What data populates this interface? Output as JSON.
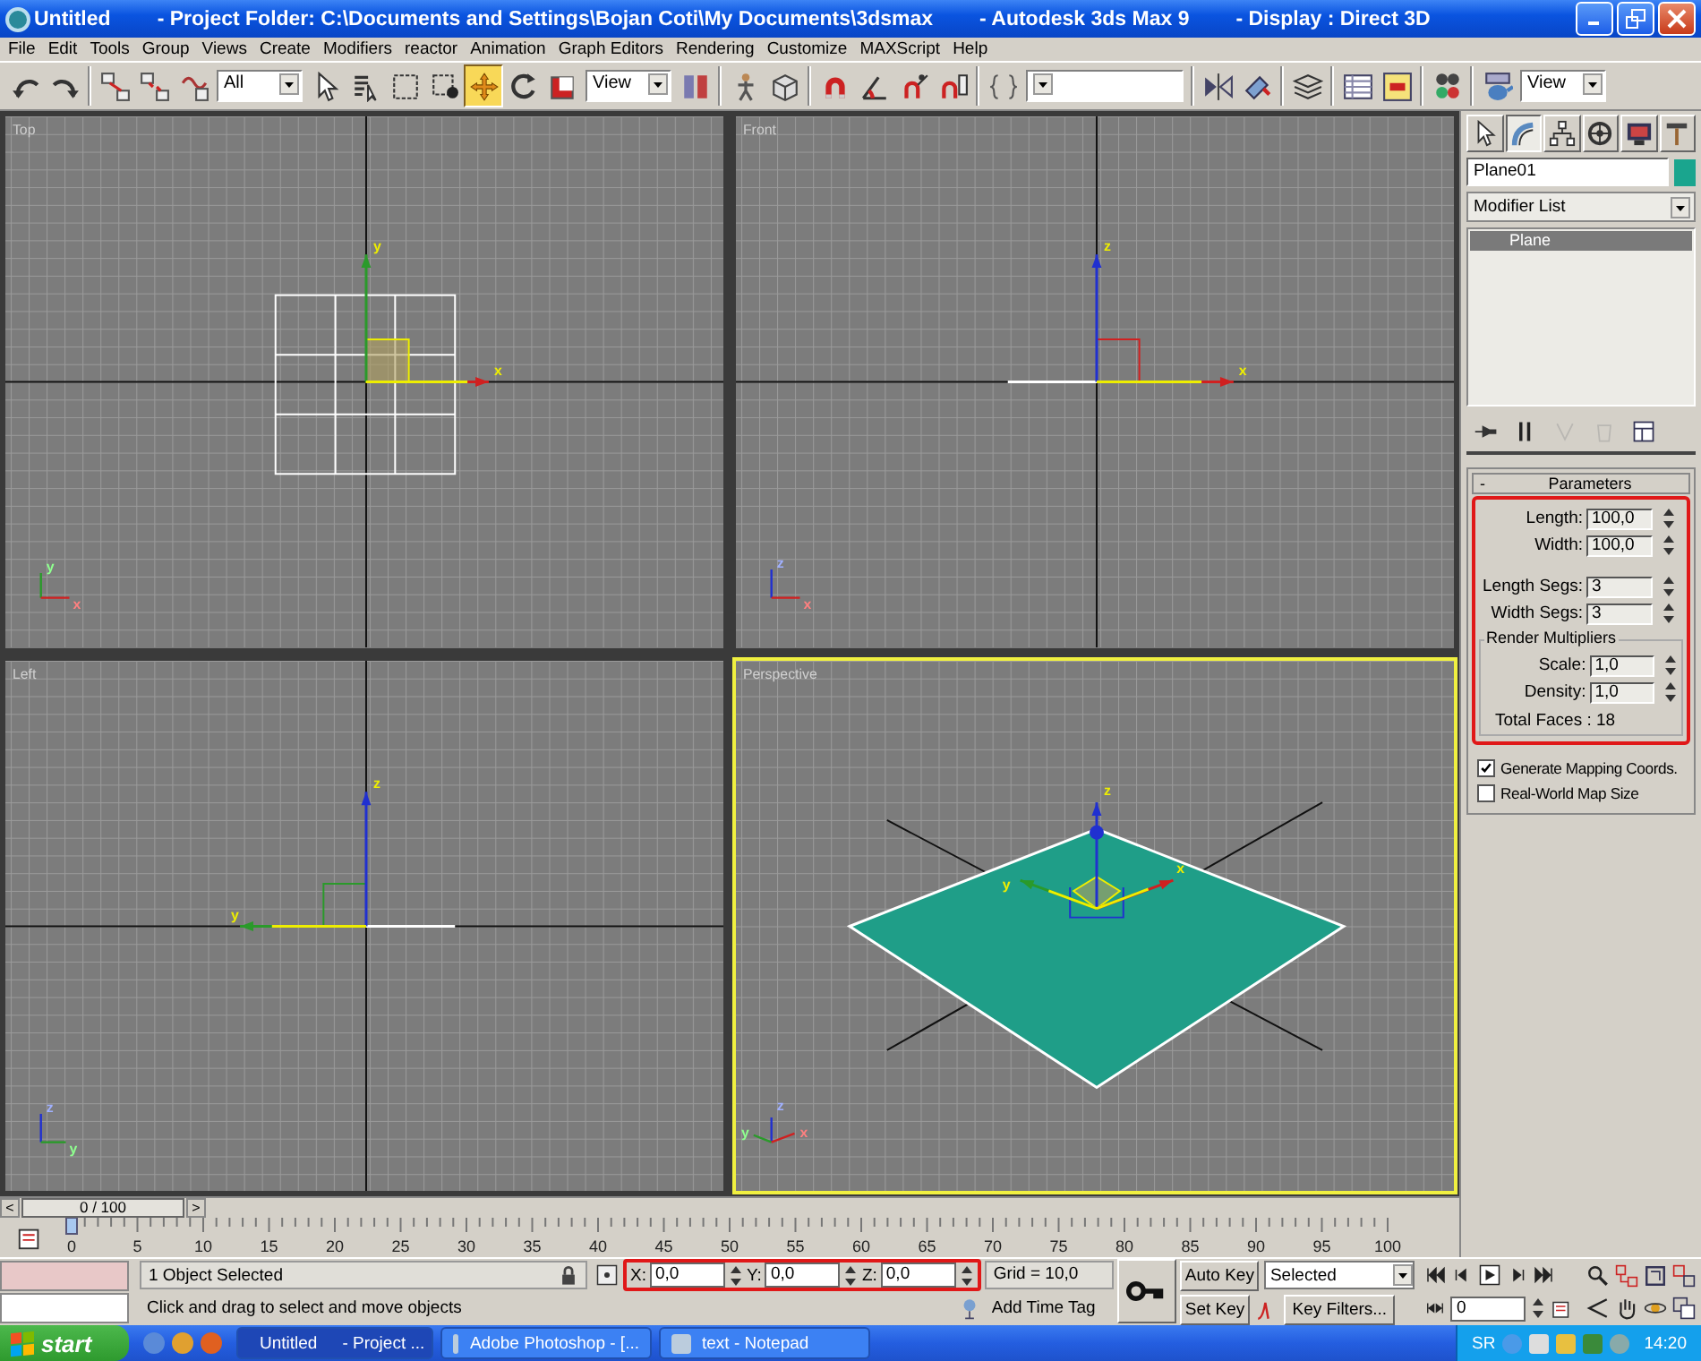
{
  "window": {
    "title_parts": [
      "Untitled",
      "- Project Folder: C:\\Documents and Settings\\Bojan Coti\\My Documents\\3dsmax",
      "- Autodesk 3ds Max 9",
      "- Display : Direct 3D"
    ]
  },
  "menu": [
    "File",
    "Edit",
    "Tools",
    "Group",
    "Views",
    "Create",
    "Modifiers",
    "reactor",
    "Animation",
    "Graph Editors",
    "Rendering",
    "Customize",
    "MAXScript",
    "Help"
  ],
  "toolbar_groups": [
    {
      "tools": [
        {
          "kind": "undo",
          "selected": false
        },
        {
          "kind": "redo",
          "selected": false
        }
      ]
    },
    {
      "tools": [
        {
          "kind": "link",
          "selected": false
        },
        {
          "kind": "unlink",
          "selected": false
        },
        {
          "kind": "bind",
          "selected": false
        },
        {
          "kind": "dropdown",
          "value": "All"
        },
        {
          "kind": "pointer",
          "selected": false
        },
        {
          "kind": "list",
          "selected": false
        },
        {
          "kind": "rect",
          "selected": false
        },
        {
          "kind": "crossing",
          "selected": false
        },
        {
          "kind": "move",
          "selected": true
        },
        {
          "kind": "rotate",
          "selected": false
        },
        {
          "kind": "scale",
          "selected": false
        },
        {
          "kind": "dropdown",
          "value": "View"
        },
        {
          "kind": "pivot",
          "selected": false
        }
      ]
    },
    {
      "tools": [
        {
          "kind": "manipulate",
          "selected": false
        },
        {
          "kind": "box",
          "selected": false
        }
      ]
    },
    {
      "tools": [
        {
          "kind": "snap",
          "selected": false
        },
        {
          "kind": "angle",
          "selected": false
        },
        {
          "kind": "percent",
          "selected": false
        },
        {
          "kind": "spinsnap",
          "selected": false
        }
      ]
    },
    {
      "tools": [
        {
          "kind": "named",
          "selected": false
        },
        {
          "kind": "combo"
        }
      ]
    },
    {
      "tools": [
        {
          "kind": "mirror",
          "selected": false
        },
        {
          "kind": "align",
          "selected": false
        }
      ]
    },
    {
      "tools": [
        {
          "kind": "layers",
          "selected": false
        }
      ]
    },
    {
      "tools": [
        {
          "kind": "curve",
          "selected": false
        },
        {
          "kind": "schematic",
          "selected": false
        }
      ]
    },
    {
      "tools": [
        {
          "kind": "material",
          "selected": false
        }
      ]
    },
    {
      "tools": [
        {
          "kind": "render",
          "selected": false
        },
        {
          "kind": "dropdown",
          "value": "View"
        }
      ]
    }
  ],
  "viewports": [
    {
      "kind": "top",
      "label": "Top",
      "selected": false,
      "gizmo_labels": [
        "y",
        "x"
      ],
      "tripod_labels": [
        "y",
        "x"
      ]
    },
    {
      "kind": "front",
      "label": "Front",
      "selected": false,
      "gizmo_labels": [
        "z",
        "x"
      ],
      "tripod_labels": [
        "z",
        "x"
      ]
    },
    {
      "kind": "left",
      "label": "Left",
      "selected": false,
      "gizmo_labels": [
        "z",
        "y"
      ],
      "tripod_labels": [
        "z",
        "y"
      ]
    },
    {
      "kind": "perspective",
      "label": "Perspective",
      "selected": true,
      "gizmo_labels": [
        "z",
        "y",
        "x"
      ],
      "tripod_labels": [
        "z",
        "y",
        "x"
      ]
    }
  ],
  "command_panel": {
    "tabs": [
      {
        "kind": "create",
        "selected": false
      },
      {
        "kind": "modify",
        "selected": true
      },
      {
        "kind": "hierarchy",
        "selected": false
      },
      {
        "kind": "motion",
        "selected": false
      },
      {
        "kind": "display",
        "selected": false
      },
      {
        "kind": "utilities",
        "selected": false
      }
    ],
    "object_name": "Plane01",
    "modifier_list": "Modifier List",
    "stack": [
      {
        "label": "Plane",
        "selected": true
      }
    ],
    "stack_tools": [
      {
        "kind": "pin",
        "disabled": false
      },
      {
        "kind": "end",
        "disabled": false
      },
      {
        "kind": "unique",
        "disabled": true
      },
      {
        "kind": "remove",
        "disabled": true
      },
      {
        "kind": "configure",
        "disabled": false
      }
    ],
    "parameters": {
      "toggle": "-",
      "title": "Parameters",
      "highlighted": true,
      "fields": [
        {
          "label": "Length:",
          "value": "100,0"
        },
        {
          "label": "Width:",
          "value": "100,0"
        }
      ],
      "segments": [
        {
          "label": "Length Segs:",
          "value": "3"
        },
        {
          "label": "Width Segs:",
          "value": "3"
        }
      ],
      "group": {
        "title": "Render Multipliers",
        "fields": [
          {
            "label": "Scale:",
            "value": "1,0"
          },
          {
            "label": "Density:",
            "value": "1,0"
          }
        ],
        "total": "Total Faces : 18"
      }
    },
    "options": [
      {
        "label": "Generate Mapping Coords.",
        "checked": true
      },
      {
        "label": "Real-World Map Size",
        "checked": false
      }
    ]
  },
  "timeline": {
    "prev": "<",
    "position": "0 / 100",
    "next": ">",
    "level": 0,
    "ruler_labels": [
      "0",
      "5",
      "10",
      "15",
      "20",
      "25",
      "30",
      "35",
      "40",
      "45",
      "50",
      "55",
      "60",
      "65",
      "70",
      "75",
      "80",
      "85",
      "90",
      "95",
      "100"
    ]
  },
  "status": {
    "selection": "1 Object Selected",
    "prompt": "Click and drag to select and move objects",
    "coords": {
      "highlighted": true,
      "fields": [
        {
          "axis": "X:",
          "value": "0,0"
        },
        {
          "axis": "Y:",
          "value": "0,0"
        },
        {
          "axis": "Z:",
          "value": "0,0"
        }
      ]
    },
    "grid": "Grid = 10,0",
    "time_tag": "Add Time Tag",
    "auto_key": "Auto Key",
    "key_set": "Selected",
    "set_key": "Set Key",
    "key_filters": "Key Filters...",
    "frame": "0"
  },
  "taskbar": {
    "start": "start",
    "tasks": [
      {
        "parts": [
          "Untitled",
          "- Project ..."
        ],
        "selected": true
      },
      {
        "parts": [
          "Adobe Photoshop - [..."
        ],
        "selected": false
      },
      {
        "parts": [
          "text - Notepad"
        ],
        "selected": false
      }
    ],
    "language": "SR",
    "clock": "14:20"
  }
}
